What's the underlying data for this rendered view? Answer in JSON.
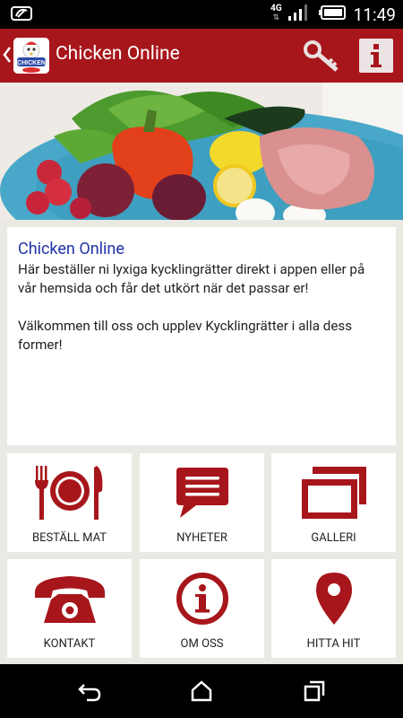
{
  "status_bar": {
    "network": "4G",
    "network_arrows": "⇅",
    "time": "11:49"
  },
  "action_bar": {
    "title": "Chicken Online",
    "logo_text": "CHICKEN"
  },
  "info_card": {
    "title": "Chicken Online",
    "paragraph1": "Här beställer ni lyxiga kycklingrätter direkt i appen eller på vår hemsida och får det utkört när det passar er!",
    "paragraph2": "Välkommen till oss och upplev Kycklingrätter i alla dess former!"
  },
  "tiles": [
    {
      "label": "BESTÄLL MAT",
      "icon": "plate-cutlery-icon"
    },
    {
      "label": "NYHETER",
      "icon": "speech-bubble-icon"
    },
    {
      "label": "GALLERI",
      "icon": "gallery-icon"
    },
    {
      "label": "KONTAKT",
      "icon": "phone-icon"
    },
    {
      "label": "OM OSS",
      "icon": "info-circle-icon"
    },
    {
      "label": "HITTA HIT",
      "icon": "map-pin-icon"
    }
  ],
  "colors": {
    "brand": "#a7161b",
    "icon": "#a7161b",
    "title_link": "#2033a8",
    "background": "#ebe9e4"
  }
}
